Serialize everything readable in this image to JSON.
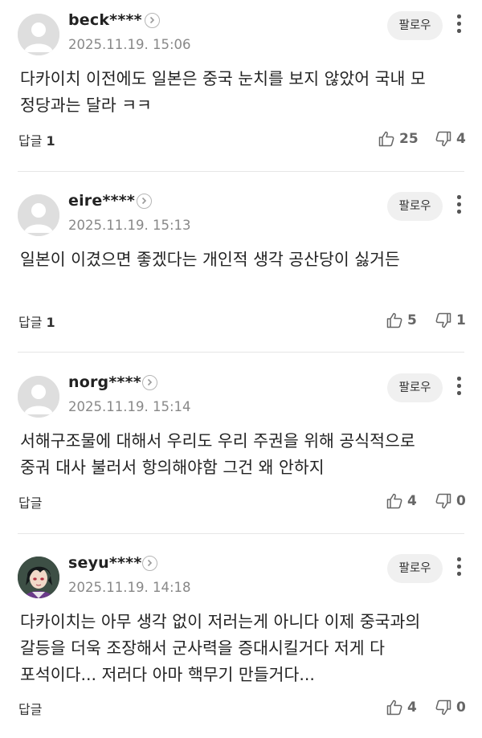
{
  "ui": {
    "follow_label": "팔로우",
    "reply_label": "답글"
  },
  "comments": [
    {
      "user": "beck****",
      "time": "2025.11.19. 15:06",
      "avatar": "default-avatar",
      "text": "다카이치 이전에도 일본은 중국 눈치를 보지 않았어 국내 모 정당과는 달라 ㅋㅋ",
      "replies": "1",
      "likes": "25",
      "dislikes": "4"
    },
    {
      "user": "eire****",
      "time": "2025.11.19. 15:13",
      "avatar": "default-avatar",
      "text": "일본이 이겼으면 좋겠다는 개인적 생각 공산당이 싫거든",
      "replies": "1",
      "likes": "5",
      "dislikes": "1"
    },
    {
      "user": "norg****",
      "time": "2025.11.19. 15:14",
      "avatar": "default-avatar",
      "text": "서해구조물에 대해서 우리도 우리 주권을 위해 공식적으로 중궈 대사 불러서 항의해야함 그건 왜 안하지",
      "replies": "",
      "likes": "4",
      "dislikes": "0"
    },
    {
      "user": "seyu****",
      "time": "2025.11.19. 14:18",
      "avatar": "character-avatar",
      "text": "다카이치는 아무 생각 없이 저러는게 아니다 이제 중국과의 갈등을 더욱 조장해서 군사력을 증대시킬거다 저게 다 포석이다... 저러다 아마 핵무기 만들거다...",
      "replies": "",
      "likes": "4",
      "dislikes": "0"
    }
  ]
}
